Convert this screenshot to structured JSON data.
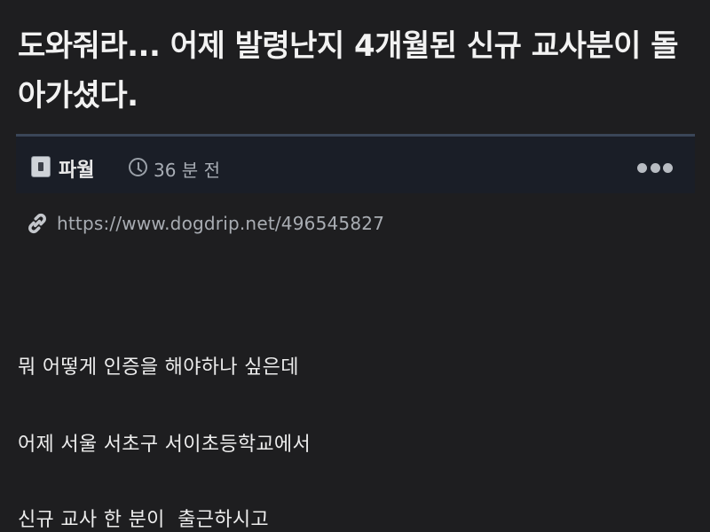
{
  "post": {
    "title": "도와줘라... 어제 발령난지 4개월된 신규 교사분이 돌아가셨다.",
    "author": "파월",
    "time_ago": "36 분 전",
    "link": "https://www.dogdrip.net/496545827"
  },
  "body": {
    "lines": [
      "뭐 어떻게 인증을 해야하나 싶은데",
      "어제 서울 서초구 서이초등학교에서",
      "신규 교사 한 분이  출근하시고"
    ]
  },
  "icons": {
    "clock": "clock-icon",
    "more": "more-options-icon",
    "link": "link-icon",
    "avatar": "avatar"
  },
  "colors": {
    "background": "#1e1e20",
    "meta_bar": "#1a1e27",
    "meta_border": "#3a4658"
  }
}
